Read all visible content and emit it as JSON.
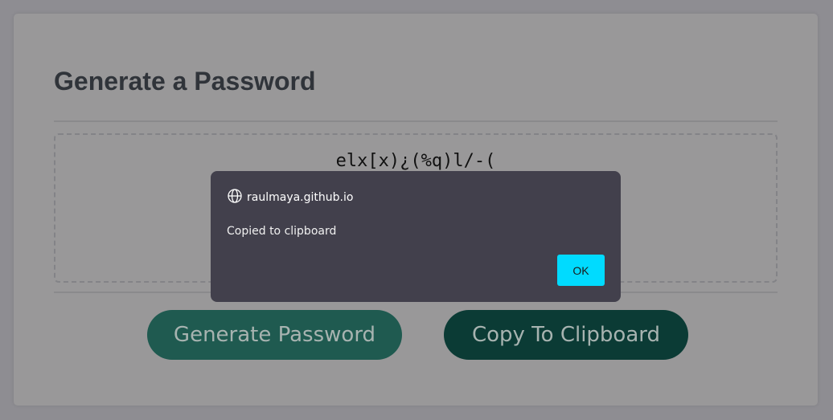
{
  "page": {
    "title": "Generate a Password",
    "password": "elx[x)¿(%q)l/-(",
    "generate_label": "Generate Password",
    "copy_label": "Copy To Clipboard"
  },
  "dialog": {
    "origin": "raulmaya.github.io",
    "message": "Copied to clipboard",
    "ok_label": "OK",
    "icon": "globe-icon"
  },
  "colors": {
    "accent_ok": "#00dbff",
    "generate_button": "#1f5a50",
    "copy_button": "#0b3b35"
  }
}
